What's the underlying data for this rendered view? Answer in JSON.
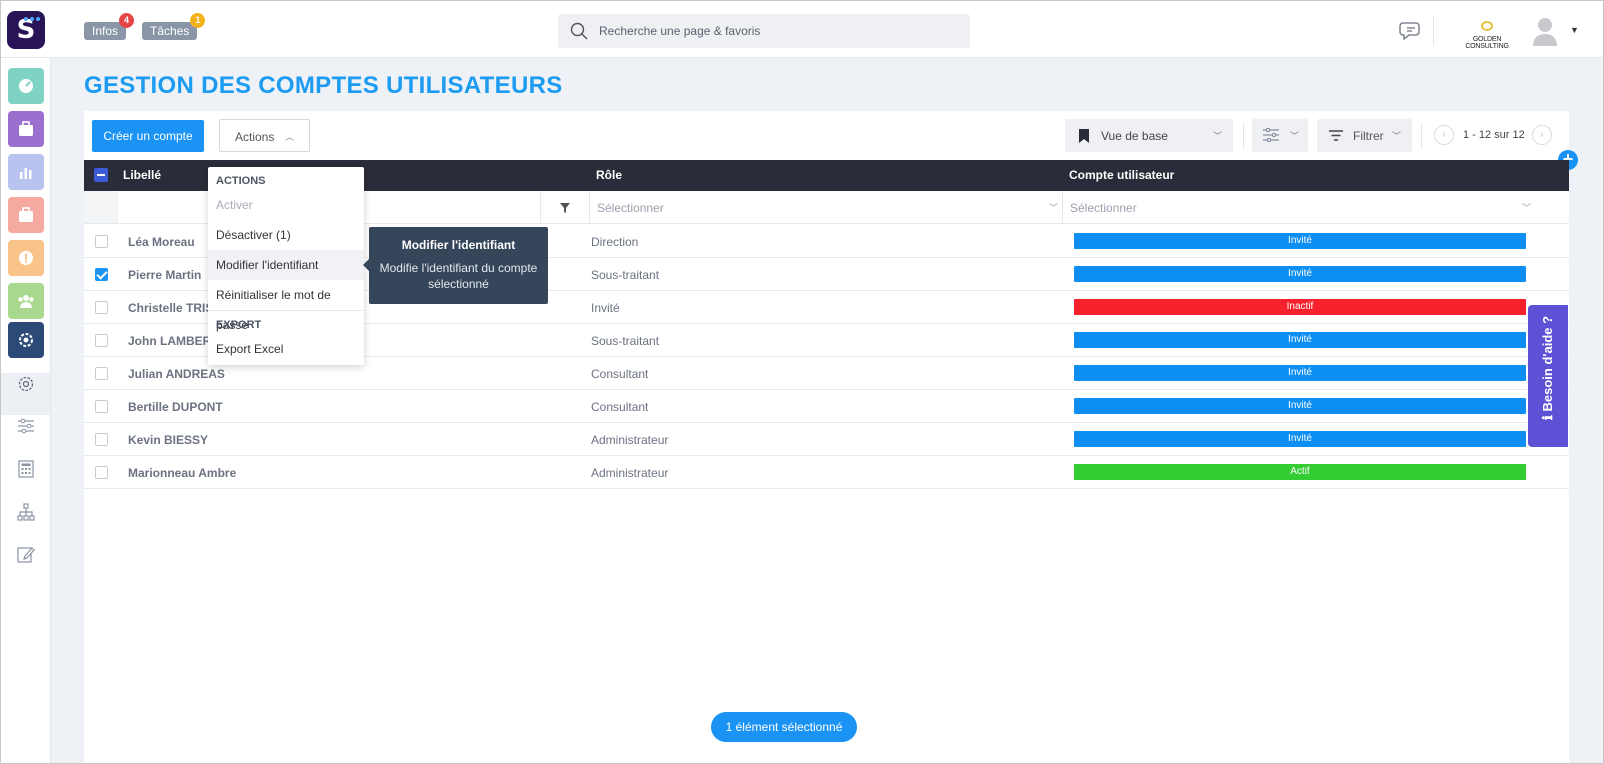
{
  "header": {
    "logo_letter": "S",
    "infos_label": "Infos",
    "infos_count": "4",
    "taches_label": "Tâches",
    "taches_count": "1",
    "search_placeholder": "Recherche une page & favoris",
    "company_name": "GOLDEN CONSULTING",
    "colors": {
      "infos_badge": "#e64545",
      "taches_badge": "#f2b21b",
      "logo_bg": "#2a1458"
    }
  },
  "sidebar": {
    "tiles": [
      {
        "name": "dashboard-icon",
        "color": "#7fd3c4"
      },
      {
        "name": "briefcase-icon",
        "color": "#9a6fce"
      },
      {
        "name": "chart-icon",
        "color": "#b8c3ef"
      },
      {
        "name": "briefcase-icon",
        "color": "#f6a99f"
      },
      {
        "name": "alert-icon",
        "color": "#f8c48a"
      },
      {
        "name": "team-icon",
        "color": "#a9d98e"
      },
      {
        "name": "settings-icon",
        "color": "#2c4a78"
      }
    ],
    "lines": [
      "gear-icon",
      "sliders-icon",
      "calculator-icon",
      "org-chart-icon",
      "edit-icon"
    ]
  },
  "page": {
    "title": "GESTION DES COMPTES UTILISATEURS"
  },
  "toolbar": {
    "create_label": "Créer un compte",
    "actions_label": "Actions",
    "view_label": "Vue de base",
    "filter_label": "Filtrer",
    "pagination": "1 - 12 sur 12"
  },
  "table": {
    "columns": [
      "Libellé",
      "Rôle",
      "Compte utilisateur"
    ],
    "filter_placeholders": [
      "Sélectionner",
      "Sélectionner"
    ],
    "rows": [
      {
        "name": "Léa Moreau",
        "role": "Direction",
        "status": "Invité",
        "color": "#0d8ef3",
        "checked": false
      },
      {
        "name": "Pierre Martin",
        "role": "Sous-traitant",
        "status": "Invité",
        "color": "#0d8ef3",
        "checked": true
      },
      {
        "name": "Christelle TRISC",
        "role": "Invité",
        "status": "Inactif",
        "color": "#f5212b",
        "checked": false
      },
      {
        "name": "John LAMBERT",
        "role": "Sous-traitant",
        "status": "Invité",
        "color": "#0d8ef3",
        "checked": false
      },
      {
        "name": "Julian ANDREAS",
        "role": "Consultant",
        "status": "Invité",
        "color": "#0d8ef3",
        "checked": false
      },
      {
        "name": "Bertille DUPONT",
        "role": "Consultant",
        "status": "Invité",
        "color": "#0d8ef3",
        "checked": false
      },
      {
        "name": "Kevin BIESSY",
        "role": "Administrateur",
        "status": "Invité",
        "color": "#0d8ef3",
        "checked": false
      },
      {
        "name": "Marionneau Ambre",
        "role": "Administrateur",
        "status": "Actif",
        "color": "#33cc33",
        "checked": false
      }
    ]
  },
  "menu": {
    "section_actions": "ACTIONS",
    "activer": "Activer",
    "desactiver": "Désactiver (1)",
    "modifier": "Modifier l'identifiant",
    "reinitialiser": "Réinitialiser le mot de passe",
    "section_export": "EXPORT",
    "export_excel": "Export Excel"
  },
  "tooltip": {
    "title": "Modifier l'identifiant",
    "text": "Modifie l'identifiant du compte sélectionné"
  },
  "help_tab": {
    "label": "Besoin d'aide ?",
    "icon": "info-icon"
  },
  "selection": {
    "label": "1 élément sélectionné"
  }
}
